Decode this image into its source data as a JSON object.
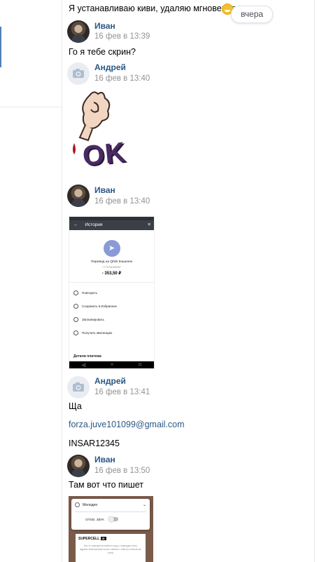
{
  "date_label": "вчера",
  "messages": [
    {
      "text": "Я устанавливаю киви, удаляю мгновенно"
    },
    {
      "author": "Иван",
      "time": "16 фев в 13:39",
      "text": "Го я тебе скрин?"
    },
    {
      "author": "Андрей",
      "time": "16 фев в 13:40",
      "sticker_text": "OK"
    },
    {
      "author": "Иван",
      "time": "16 фев в 13:40"
    },
    {
      "author": "Андрей",
      "time": "16 фев в 13:41",
      "text": "Ща",
      "link": "forza.juve101099@gmail.com",
      "text2": "INSAR12345"
    },
    {
      "author": "Иван",
      "time": "16 фев в 13:50",
      "text": "Там вот что пишет"
    }
  ],
  "screenshot1": {
    "header": "История",
    "title": "Перевод на QIWI Кошелек",
    "phone": "+77078009987",
    "amount": "- 353,50 ₽",
    "actions": [
      "Повторить",
      "Сохранить в Избранное",
      "Запланировать",
      "Получить квитанцию"
    ],
    "footer": "Детали платежа"
  },
  "screenshot2": {
    "item1": "Мелодия",
    "item2": "ОПОВ. ЗВУК",
    "brand": "SUPERCELL",
    "brand_badge": "ID",
    "body": "Кто-то пользуется войти в игру с помощью этого адреса электронной почты, сменит с нам ки голосов же голос"
  },
  "icons": [
    "grinning-emoji-icon",
    "camera-icon",
    "back-arrow-icon",
    "filter-icon",
    "send-icon",
    "repeat-icon",
    "star-icon",
    "clock-icon",
    "receipt-icon",
    "toggle-icon",
    "settings-icon"
  ]
}
